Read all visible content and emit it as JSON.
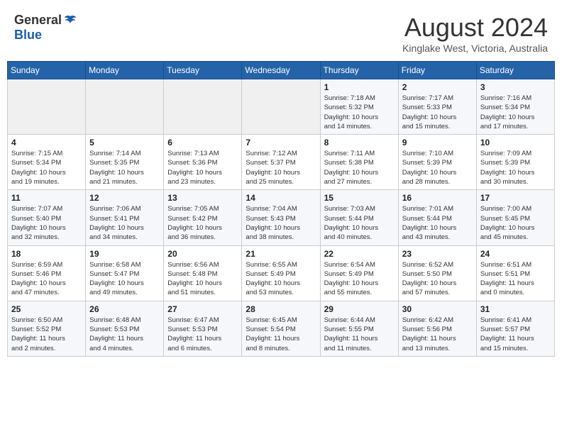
{
  "header": {
    "logo_general": "General",
    "logo_blue": "Blue",
    "month_year": "August 2024",
    "location": "Kinglake West, Victoria, Australia"
  },
  "days_of_week": [
    "Sunday",
    "Monday",
    "Tuesday",
    "Wednesday",
    "Thursday",
    "Friday",
    "Saturday"
  ],
  "weeks": [
    [
      {
        "day": "",
        "info": ""
      },
      {
        "day": "",
        "info": ""
      },
      {
        "day": "",
        "info": ""
      },
      {
        "day": "",
        "info": ""
      },
      {
        "day": "1",
        "info": "Sunrise: 7:18 AM\nSunset: 5:32 PM\nDaylight: 10 hours\nand 14 minutes."
      },
      {
        "day": "2",
        "info": "Sunrise: 7:17 AM\nSunset: 5:33 PM\nDaylight: 10 hours\nand 15 minutes."
      },
      {
        "day": "3",
        "info": "Sunrise: 7:16 AM\nSunset: 5:34 PM\nDaylight: 10 hours\nand 17 minutes."
      }
    ],
    [
      {
        "day": "4",
        "info": "Sunrise: 7:15 AM\nSunset: 5:34 PM\nDaylight: 10 hours\nand 19 minutes."
      },
      {
        "day": "5",
        "info": "Sunrise: 7:14 AM\nSunset: 5:35 PM\nDaylight: 10 hours\nand 21 minutes."
      },
      {
        "day": "6",
        "info": "Sunrise: 7:13 AM\nSunset: 5:36 PM\nDaylight: 10 hours\nand 23 minutes."
      },
      {
        "day": "7",
        "info": "Sunrise: 7:12 AM\nSunset: 5:37 PM\nDaylight: 10 hours\nand 25 minutes."
      },
      {
        "day": "8",
        "info": "Sunrise: 7:11 AM\nSunset: 5:38 PM\nDaylight: 10 hours\nand 27 minutes."
      },
      {
        "day": "9",
        "info": "Sunrise: 7:10 AM\nSunset: 5:39 PM\nDaylight: 10 hours\nand 28 minutes."
      },
      {
        "day": "10",
        "info": "Sunrise: 7:09 AM\nSunset: 5:39 PM\nDaylight: 10 hours\nand 30 minutes."
      }
    ],
    [
      {
        "day": "11",
        "info": "Sunrise: 7:07 AM\nSunset: 5:40 PM\nDaylight: 10 hours\nand 32 minutes."
      },
      {
        "day": "12",
        "info": "Sunrise: 7:06 AM\nSunset: 5:41 PM\nDaylight: 10 hours\nand 34 minutes."
      },
      {
        "day": "13",
        "info": "Sunrise: 7:05 AM\nSunset: 5:42 PM\nDaylight: 10 hours\nand 36 minutes."
      },
      {
        "day": "14",
        "info": "Sunrise: 7:04 AM\nSunset: 5:43 PM\nDaylight: 10 hours\nand 38 minutes."
      },
      {
        "day": "15",
        "info": "Sunrise: 7:03 AM\nSunset: 5:44 PM\nDaylight: 10 hours\nand 40 minutes."
      },
      {
        "day": "16",
        "info": "Sunrise: 7:01 AM\nSunset: 5:44 PM\nDaylight: 10 hours\nand 43 minutes."
      },
      {
        "day": "17",
        "info": "Sunrise: 7:00 AM\nSunset: 5:45 PM\nDaylight: 10 hours\nand 45 minutes."
      }
    ],
    [
      {
        "day": "18",
        "info": "Sunrise: 6:59 AM\nSunset: 5:46 PM\nDaylight: 10 hours\nand 47 minutes."
      },
      {
        "day": "19",
        "info": "Sunrise: 6:58 AM\nSunset: 5:47 PM\nDaylight: 10 hours\nand 49 minutes."
      },
      {
        "day": "20",
        "info": "Sunrise: 6:56 AM\nSunset: 5:48 PM\nDaylight: 10 hours\nand 51 minutes."
      },
      {
        "day": "21",
        "info": "Sunrise: 6:55 AM\nSunset: 5:49 PM\nDaylight: 10 hours\nand 53 minutes."
      },
      {
        "day": "22",
        "info": "Sunrise: 6:54 AM\nSunset: 5:49 PM\nDaylight: 10 hours\nand 55 minutes."
      },
      {
        "day": "23",
        "info": "Sunrise: 6:52 AM\nSunset: 5:50 PM\nDaylight: 10 hours\nand 57 minutes."
      },
      {
        "day": "24",
        "info": "Sunrise: 6:51 AM\nSunset: 5:51 PM\nDaylight: 11 hours\nand 0 minutes."
      }
    ],
    [
      {
        "day": "25",
        "info": "Sunrise: 6:50 AM\nSunset: 5:52 PM\nDaylight: 11 hours\nand 2 minutes."
      },
      {
        "day": "26",
        "info": "Sunrise: 6:48 AM\nSunset: 5:53 PM\nDaylight: 11 hours\nand 4 minutes."
      },
      {
        "day": "27",
        "info": "Sunrise: 6:47 AM\nSunset: 5:53 PM\nDaylight: 11 hours\nand 6 minutes."
      },
      {
        "day": "28",
        "info": "Sunrise: 6:45 AM\nSunset: 5:54 PM\nDaylight: 11 hours\nand 8 minutes."
      },
      {
        "day": "29",
        "info": "Sunrise: 6:44 AM\nSunset: 5:55 PM\nDaylight: 11 hours\nand 11 minutes."
      },
      {
        "day": "30",
        "info": "Sunrise: 6:42 AM\nSunset: 5:56 PM\nDaylight: 11 hours\nand 13 minutes."
      },
      {
        "day": "31",
        "info": "Sunrise: 6:41 AM\nSunset: 5:57 PM\nDaylight: 11 hours\nand 15 minutes."
      }
    ]
  ]
}
